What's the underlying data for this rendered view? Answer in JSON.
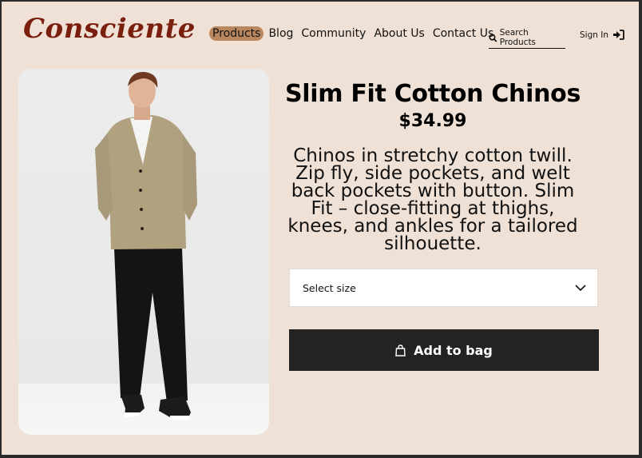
{
  "brand": {
    "logo_text": "Consciente",
    "logo_color": "#7a1f0e"
  },
  "nav": {
    "items": [
      {
        "label": "Products",
        "active": true
      },
      {
        "label": "Blog"
      },
      {
        "label": "Community"
      },
      {
        "label": "About Us"
      },
      {
        "label": "Contact Us"
      }
    ],
    "search_label": "Search Products",
    "search_icon": "search-icon",
    "signin_label": "Sign In",
    "signin_icon": "sign-in-icon"
  },
  "product": {
    "image_alt": "Model wearing beige cardigan and black chinos",
    "title": "Slim Fit Cotton Chinos",
    "price": "$34.99",
    "description": "Chinos in stretchy cotton twill. Zip fly, side pockets, and welt back pockets with button. Slim Fit – close-fitting at thighs, knees, and ankles for a tailored silhouette.",
    "size_select": {
      "selected": "Select size",
      "icon": "chevron-down-icon"
    },
    "add_to_bag": {
      "label": "Add to bag",
      "icon": "shopping-bag-icon"
    }
  },
  "colors": {
    "page_background": "#efe1d6",
    "active_nav": "#b9875f",
    "button_background": "#232323"
  }
}
